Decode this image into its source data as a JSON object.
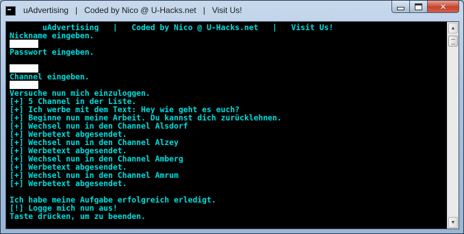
{
  "window": {
    "title": "uAdvertising   |   Coded by Nico @ U-Hacks.net   |   Visit Us!",
    "icon": "console-app-icon",
    "controls": {
      "minimize": "minimize-icon",
      "maximize": "maximize-icon",
      "close": "✕"
    }
  },
  "colors": {
    "console_bg": "#000000",
    "console_text": "#00dede",
    "close_button": "#c7432a"
  },
  "console": {
    "lines": [
      "       uAdvertising   |   Coded by Nico @ U-Hacks.net   |   Visit Us!",
      "Nickname eingeben.",
      "",
      "Passwort eingeben.",
      "",
      "",
      "Channel eingeben.",
      "",
      "Versuche nun mich einzuloggen.",
      "[+] 5 Channel in der Liste.",
      "[+] Ich werbe mit dem Text: Hey wie geht es euch?",
      "[+] Beginne nun meine Arbeit. Du kannst dich zurücklehnen.",
      "[+] Wechsel nun in den Channel Alsdorf",
      "[+] Werbetext abgesendet.",
      "[+] Wechsel nun in den Channel Alzey",
      "[+] Werbetext abgesendet.",
      "[+] Wechsel nun in den Channel Amberg",
      "[+] Werbetext abgesendet.",
      "[+] Wechsel nun in den Channel Amrum",
      "[+] Werbetext abgesendet.",
      "",
      "Ich habe meine Aufgabe erfolgreich erledigt.",
      "[!] Logge mich nun aus!",
      "Taste drücken, um zu beenden."
    ],
    "masked_input_lines": [
      2,
      5,
      7
    ]
  },
  "scrollbar": {
    "up": "▲",
    "down": "▼"
  }
}
